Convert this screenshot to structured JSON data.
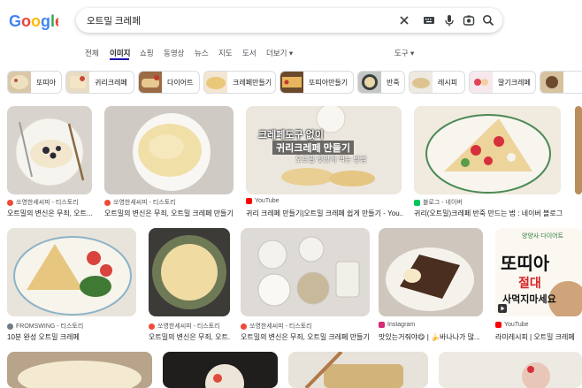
{
  "search": {
    "query": "오트밀 크레페"
  },
  "tabs": [
    "전체",
    "이미지",
    "쇼핑",
    "동영상",
    "뉴스",
    "지도",
    "도서",
    "더보기 ▾"
  ],
  "active_tab": "이미지",
  "tools_label": "도구 ▾",
  "chips": [
    "또띠아",
    "귀리크레페",
    "다이어트",
    "크레페만들기",
    "또띠아만들기",
    "반죽",
    "레시피",
    "딸기크레페"
  ],
  "results": [
    {
      "source": "쏘영한세씨피 - 티스토리",
      "caption": "오트밀의 변신은 무죄, 오트..."
    },
    {
      "source": "쏘영한세씨피 - 티스토리",
      "caption": "오트밀의 변신은 무죄, 오트밀 크레페 만들기"
    },
    {
      "source": "YouTube",
      "caption": "귀리 크레페 만들기|오트밀 크레페 쉽게 만들기 - You...",
      "thumb_title_1": "크레페도구 없이",
      "thumb_title_2": "귀리크레페 만들기",
      "thumb_sub": "오트밀 맛있게 먹는 방법"
    },
    {
      "source": "블로그 - 네이버",
      "caption": "귀리(오트밀)크레페 반죽 만드는 법 : 네이버 블로그"
    },
    {
      "source": "FROMSWING - 티스토리",
      "caption": "10분 완성 오트밀 크레페"
    },
    {
      "source": "쏘영한세씨피 - 티스토리",
      "caption": "오트밀의 변신은 무죄, 오트..."
    },
    {
      "source": "쏘영한세씨피 - 티스토리",
      "caption": "오트밀의 변신은 무죄, 오트밀 크레페 만들기"
    },
    {
      "source": "Instagram",
      "caption": "맛있는거줘야😋 | 🍌바나나가 많..."
    },
    {
      "source": "YouTube",
      "caption": "라미레시피 | 오트밀 크레페",
      "thumb_small": "양양사 다이어트",
      "thumb_big": "또띠아",
      "thumb_red": "절대",
      "thumb_bottom": "사먹지마세요"
    }
  ],
  "colors": {
    "accent": "#1a0dab",
    "tistory": "#f04a3a",
    "youtube": "#ff0000",
    "naver": "#03c75a"
  }
}
